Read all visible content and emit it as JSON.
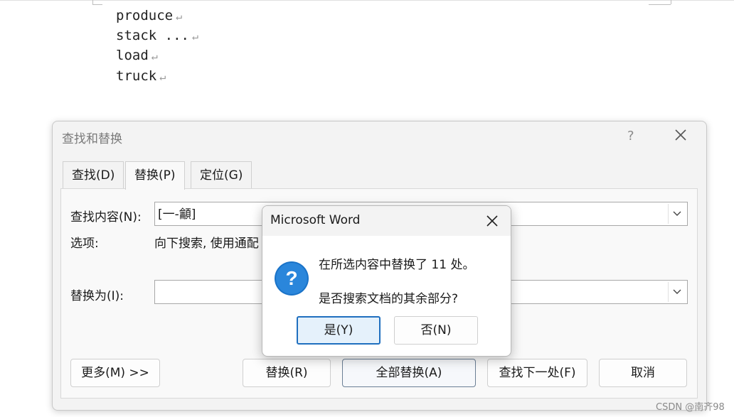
{
  "document": {
    "lines": [
      "produce",
      "stack ...",
      "load",
      "truck"
    ],
    "line_end_mark": "↵"
  },
  "find_replace": {
    "title": "查找和替换",
    "help": "?",
    "tabs": [
      "查找(D)",
      "替换(P)",
      "定位(G)"
    ],
    "active_tab": "替换(P)",
    "find_label": "查找内容(N):",
    "find_value": "[一-龥]",
    "options_label": "选项:",
    "options_value": "向下搜索, 使用通配",
    "replace_label": "替换为(I):",
    "replace_value": "",
    "buttons": {
      "more": "更多(M) >>",
      "replace": "替换(R)",
      "replace_all": "全部替换(A)",
      "find_next": "查找下一处(F)",
      "cancel": "取消"
    }
  },
  "message_box": {
    "title": "Microsoft Word",
    "line1": "在所选内容中替换了 11 处。",
    "line2": "是否搜索文档的其余部分?",
    "yes": "是(Y)",
    "no": "否(N)",
    "icon": "question-icon"
  },
  "watermark": "CSDN @南齐98",
  "colors": {
    "accent": "#1f6fbf",
    "question_icon": "#1a73c8"
  }
}
